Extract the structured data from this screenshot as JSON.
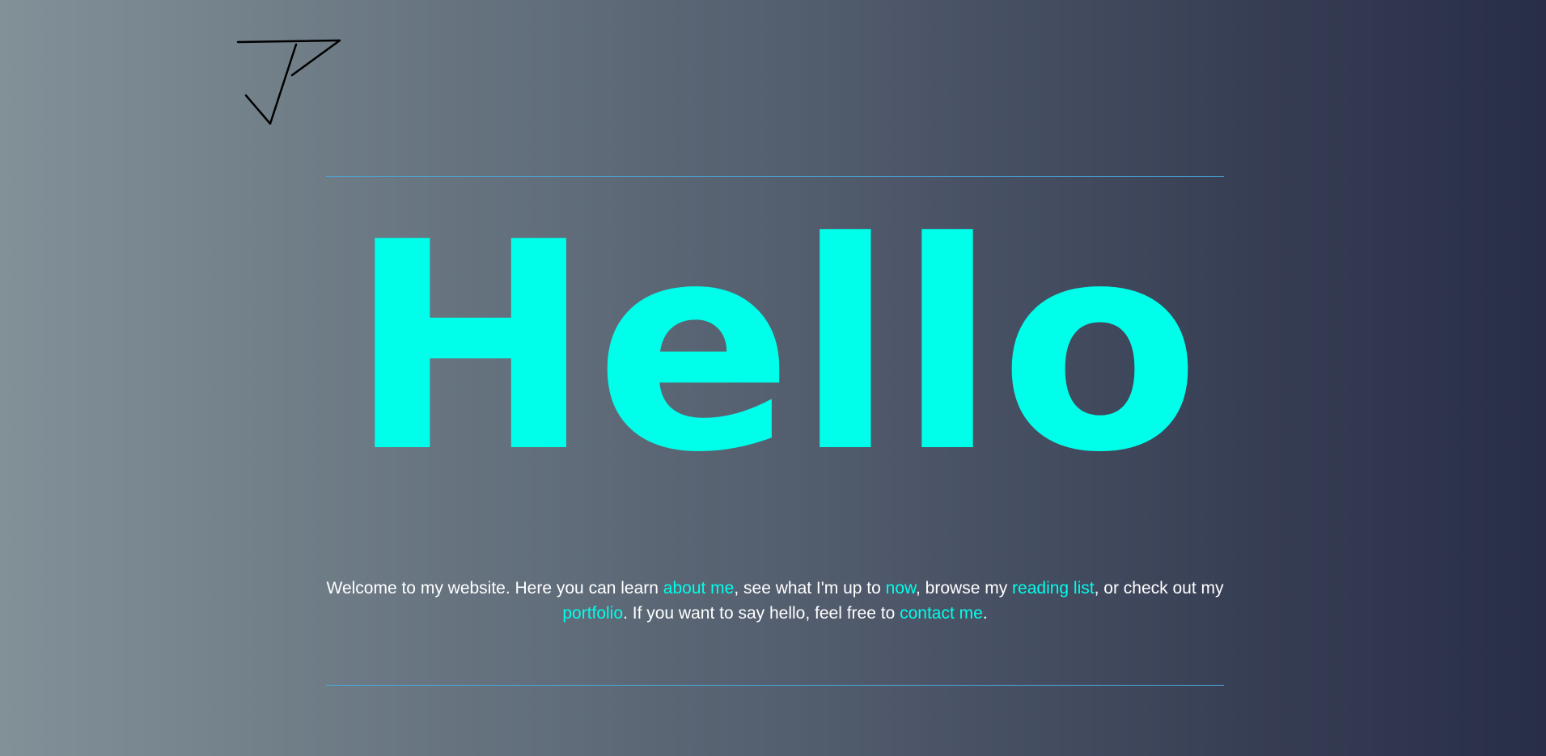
{
  "logo": {
    "icon": "jp-signature-logo",
    "stroke_color": "#000000"
  },
  "hero": {
    "title": "Hello",
    "color": "#00ffea"
  },
  "intro": {
    "t1": "Welcome to my website. Here you can learn ",
    "link_about": "about me",
    "t2": ", see what I'm up to ",
    "link_now": "now",
    "t3": ", browse my ",
    "link_reading": "reading list",
    "t4": ", or check out my ",
    "link_portfolio": "portfolio",
    "t5": ". If you want to say hello, feel free to ",
    "link_contact": "contact me",
    "t6": "."
  },
  "colors": {
    "background_start": "#829198",
    "background_end": "#282e48",
    "accent": "#00ffea",
    "divider": "#4aa8e0",
    "text": "#ffffff"
  }
}
